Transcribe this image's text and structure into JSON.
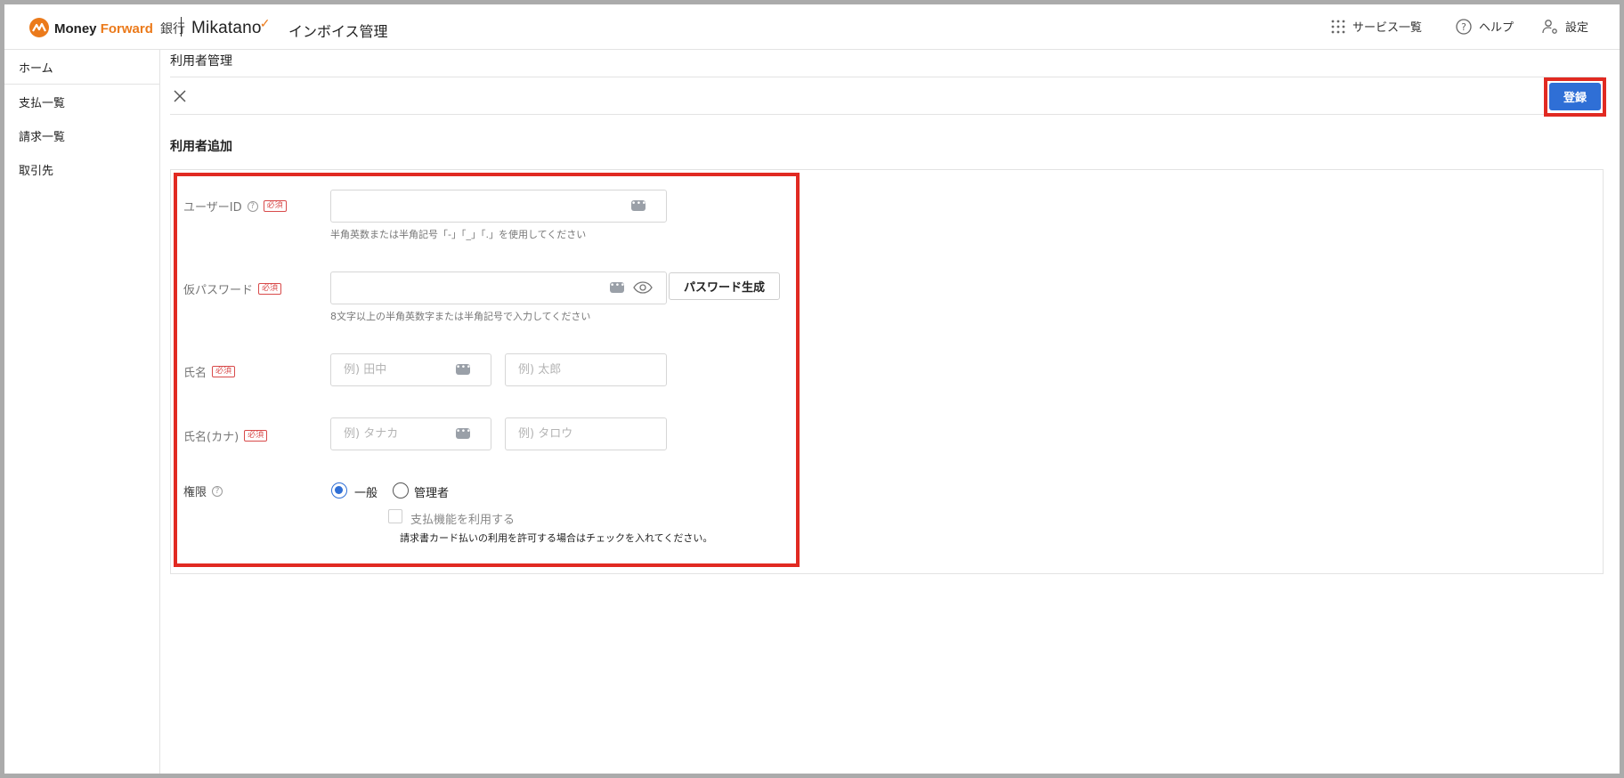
{
  "header": {
    "brand_money": "Money",
    "brand_forward": "Forward",
    "brand_bank": "銀行",
    "brand_mikatano": "Mikatano",
    "brand_subtitle": "インボイス管理",
    "nav": [
      {
        "label": "サービス一覧",
        "icon": "grid-icon"
      },
      {
        "label": "ヘルプ",
        "icon": "help-circle-icon"
      },
      {
        "label": "設定",
        "icon": "user-settings-icon"
      }
    ]
  },
  "sidebar": {
    "items": [
      {
        "label": "ホーム"
      },
      {
        "label": "支払一覧"
      },
      {
        "label": "請求一覧"
      },
      {
        "label": "取引先"
      }
    ]
  },
  "main": {
    "page_title": "利用者管理",
    "register_label": "登録",
    "section_title": "利用者追加",
    "required_badge": "必須",
    "form": {
      "user_id": {
        "label": "ユーザーID",
        "value": "",
        "hint": "半角英数または半角記号「-」「_」「.」を使用してください"
      },
      "temp_password": {
        "label": "仮パスワード",
        "value": "",
        "hint": "8文字以上の半角英数字または半角記号で入力してください",
        "generate_label": "パスワード生成"
      },
      "name": {
        "label": "氏名",
        "last_placeholder": "例) 田中",
        "first_placeholder": "例) 太郎"
      },
      "name_kana": {
        "label": "氏名(カナ)",
        "last_placeholder": "例) タナカ",
        "first_placeholder": "例) タロウ"
      },
      "role": {
        "label": "権限",
        "options": [
          {
            "label": "一般",
            "selected": true
          },
          {
            "label": "管理者",
            "selected": false
          }
        ],
        "payment_checkbox_label": "支払機能を利用する",
        "payment_checkbox_checked": false,
        "payment_hint": "請求書カード払いの利用を許可する場合はチェックを入れてください。"
      }
    }
  },
  "colors": {
    "accent": "#2f6fd6",
    "highlight": "#e12a22",
    "brand_orange": "#eb7a1b",
    "required": "#d84a4a"
  }
}
